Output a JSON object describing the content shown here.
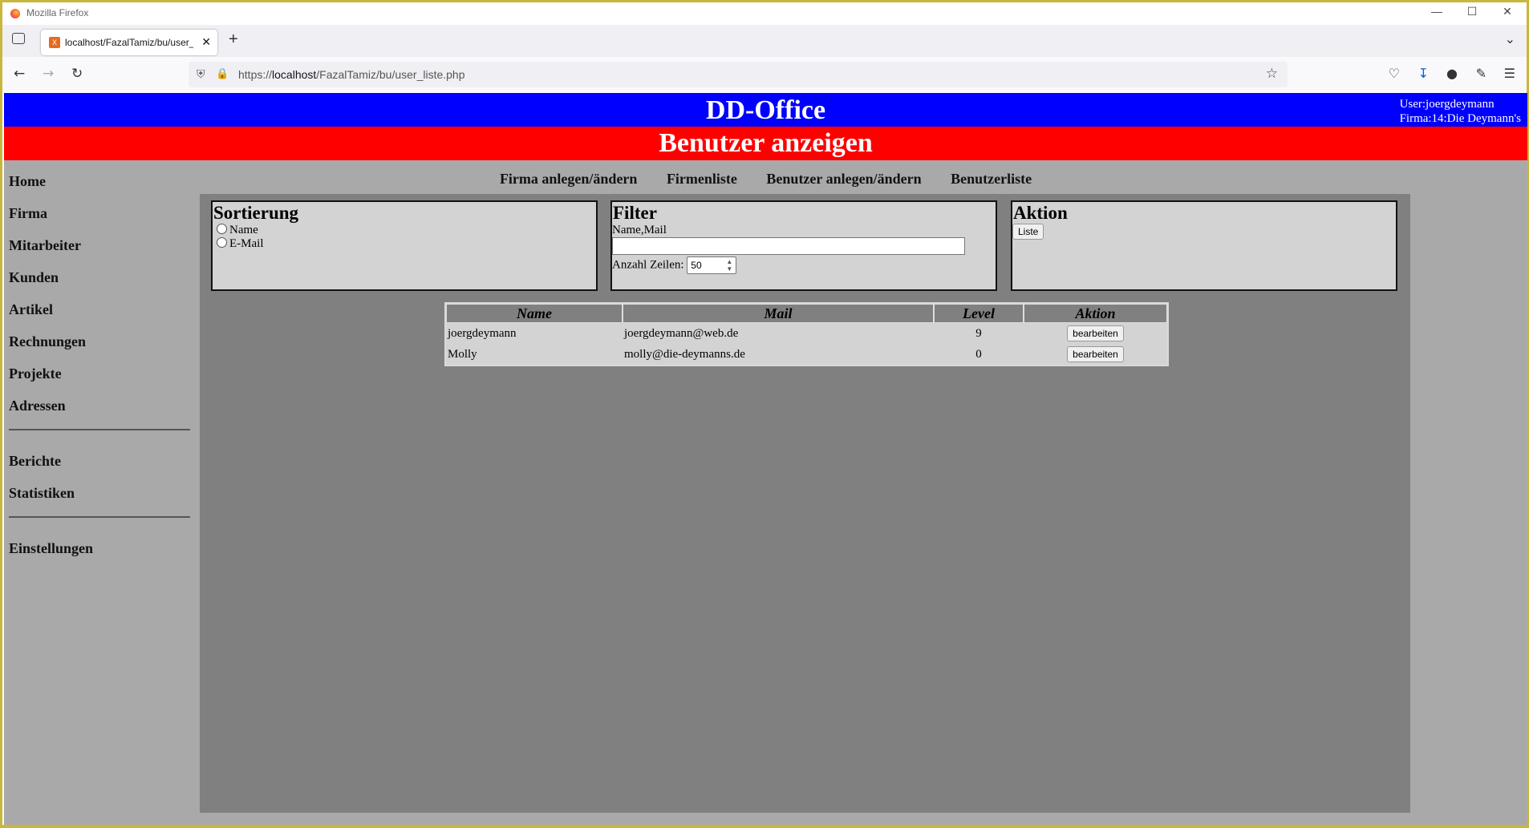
{
  "browser": {
    "window_title": "Mozilla Firefox",
    "tab_title": "localhost/FazalTamiz/bu/user_li",
    "url_prefix": "https://",
    "url_host": "localhost",
    "url_path": "/FazalTamiz/bu/user_liste.php"
  },
  "header": {
    "app_title": "DD-Office",
    "user": "User:joergdeymann",
    "company": "Firma:14:Die Deymann's",
    "page_title": "Benutzer anzeigen"
  },
  "left_nav": {
    "group1": [
      "Home",
      "Firma",
      "Mitarbeiter",
      "Kunden",
      "Artikel",
      "Rechnungen",
      "Projekte",
      "Adressen"
    ],
    "group2": [
      "Berichte",
      "Statistiken"
    ],
    "group3": [
      "Einstellungen"
    ]
  },
  "top_menu": [
    "Firma anlegen/ändern",
    "Firmenliste",
    "Benutzer anlegen/ändern",
    "Benutzerliste"
  ],
  "sort_box": {
    "title": "Sortierung",
    "options": [
      "Name",
      "E-Mail"
    ]
  },
  "filter_box": {
    "title": "Filter",
    "field_label": "Name,Mail",
    "field_value": "",
    "rows_label": "Anzahl Zeilen:",
    "rows_value": "50"
  },
  "action_box": {
    "title": "Aktion",
    "button": "Liste"
  },
  "table": {
    "headers": [
      "Name",
      "Mail",
      "Level",
      "Aktion"
    ],
    "rows": [
      {
        "name": "joergdeymann",
        "mail": "joergdeymann@web.de",
        "level": "9",
        "action": "bearbeiten"
      },
      {
        "name": "Molly",
        "mail": "molly@die-deymanns.de",
        "level": "0",
        "action": "bearbeiten"
      }
    ]
  },
  "colors": {
    "header_blue": "#0000ff",
    "subheader_red": "#ff0000",
    "sidebar_gray": "#a9a9a9",
    "content_gray": "#808080",
    "box_gray": "#d3d3d3"
  }
}
